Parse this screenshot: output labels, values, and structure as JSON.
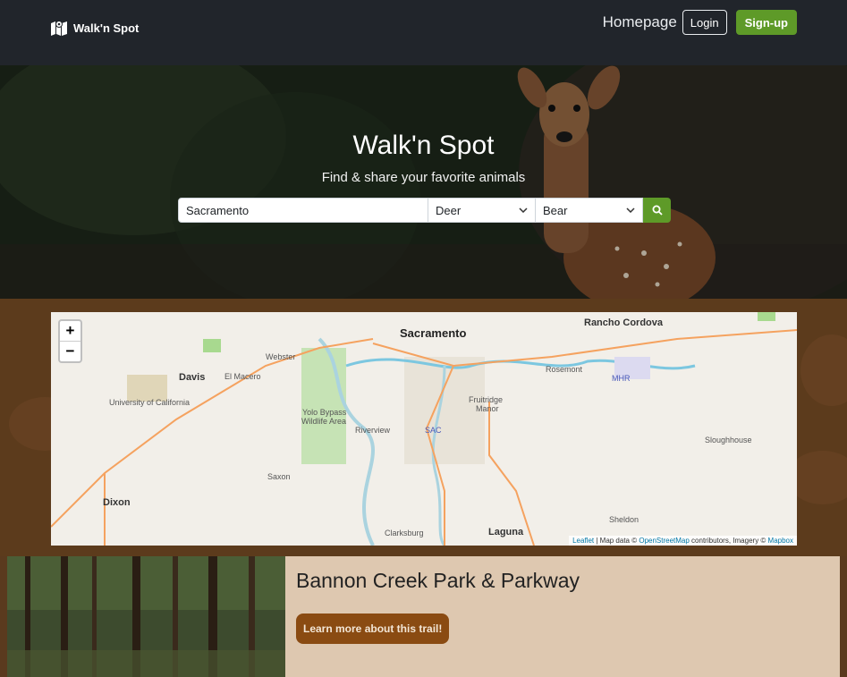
{
  "navbar": {
    "brand": "Walk'n Spot",
    "home_link": "Homepage",
    "login_label": "Login",
    "signup_label": "Sign-up"
  },
  "hero": {
    "title": "Walk'n Spot",
    "subtitle": "Find & share your favorite animals",
    "search": {
      "location_value": "Sacramento",
      "animal_select_1": "Deer",
      "animal_select_2": "Bear"
    }
  },
  "map": {
    "zoom_in": "+",
    "zoom_out": "−",
    "labels": {
      "sacramento": "Sacramento",
      "rancho_cordova": "Rancho Cordova",
      "davis": "Davis",
      "el_macero": "El Macero",
      "webster": "Webster",
      "university": "University of California",
      "yolo": "Yolo Bypass",
      "yolo2": "Wildlife Area",
      "fruitridge": "Fruitridge",
      "manor": "Manor",
      "rosemont": "Rosemont",
      "riverview": "Riverview",
      "sloughhouse": "Sloughhouse",
      "saxon": "Saxon",
      "dixon": "Dixon",
      "sheldon": "Sheldon",
      "clarksburg": "Clarksburg",
      "laguna": "Laguna",
      "sac": "SAC",
      "mhr": "MHR"
    },
    "attribution": {
      "leaflet": "Leaflet",
      "text1": " | Map data © ",
      "osm": "OpenStreetMap",
      "text2": " contributors, Imagery © ",
      "mapbox": "Mapbox"
    }
  },
  "trail": {
    "title": "Bannon Creek Park & Parkway",
    "button_label": "Learn more about this trail!"
  },
  "colors": {
    "navbar_bg": "#21252b",
    "accent_green": "#5e9a28",
    "brown_bg": "#5c3b1c",
    "card_bg": "#dec8b0",
    "button_brown": "#8a4b12"
  }
}
